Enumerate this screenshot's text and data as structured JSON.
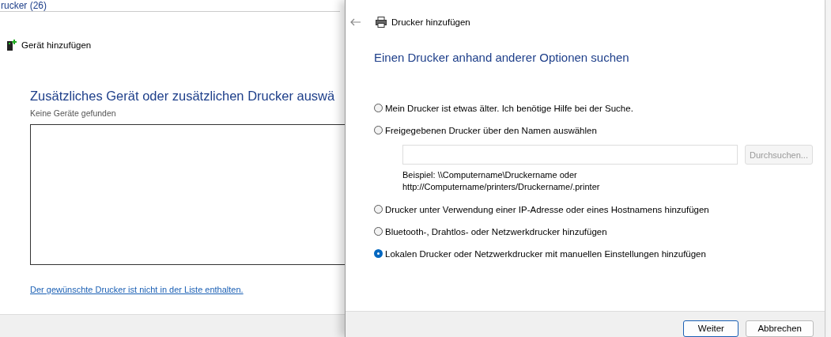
{
  "back_window": {
    "title": "rucker (26)",
    "toolbar": {
      "add_device": "Gerät hinzufügen"
    },
    "heading": "Zusätzliches Gerät oder zusätzlichen Drucker auswä",
    "status": "Keine Geräte gefunden",
    "link": "Der gewünschte Drucker ist nicht in der Liste enthalten."
  },
  "dialog": {
    "title": "Drucker hinzufügen",
    "heading": "Einen Drucker anhand anderer Optionen suchen",
    "options": [
      {
        "label": "Mein Drucker ist etwas älter. Ich benötige Hilfe bei der Suche.",
        "selected": false
      },
      {
        "label": "Freigegebenen Drucker über den Namen auswählen",
        "selected": false,
        "share": {
          "browse": "Durchsuchen...",
          "browse_disabled": true,
          "example": [
            "Beispiel: \\\\Computername\\Druckername oder",
            "http://Computername/printers/Druckername/.printer"
          ]
        }
      },
      {
        "label": "Drucker unter Verwendung einer IP-Adresse oder eines Hostnamens hinzufügen",
        "selected": false
      },
      {
        "label": "Bluetooth-, Drahtlos- oder Netzwerkdrucker hinzufügen",
        "selected": false
      },
      {
        "label": "Lokalen Drucker oder Netzwerkdrucker mit manuellen Einstellungen hinzufügen",
        "selected": true
      }
    ],
    "buttons": [
      {
        "label": "Weiter",
        "default": true
      },
      {
        "label": "Abbrechen",
        "default": false
      }
    ]
  }
}
